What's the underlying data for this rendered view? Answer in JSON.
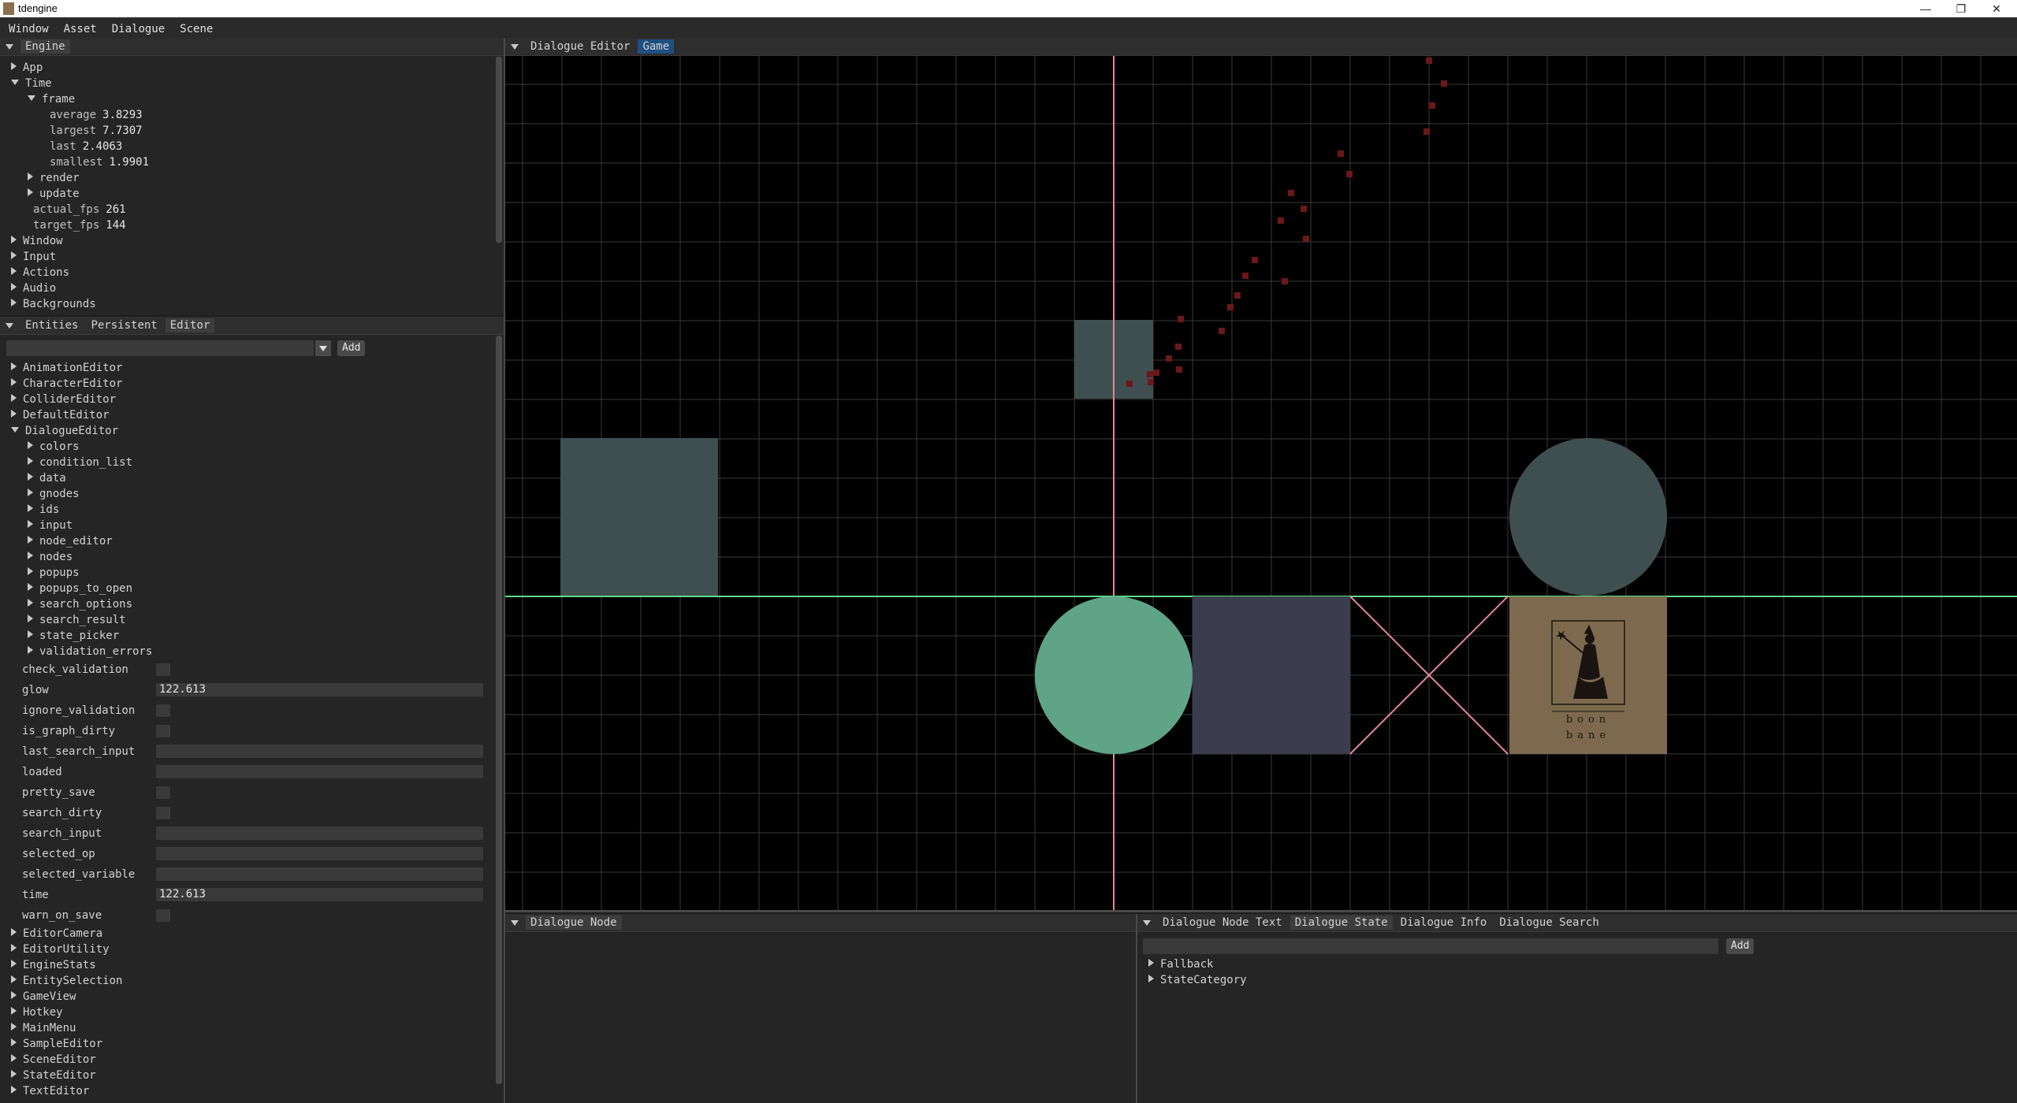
{
  "window": {
    "title": "tdengine",
    "controls": {
      "minimize": "—",
      "maximize": "❐",
      "close": "✕"
    }
  },
  "menu": [
    "Window",
    "Asset",
    "Dialogue",
    "Scene"
  ],
  "engine_panel": {
    "tab": "Engine",
    "tree": [
      {
        "label": "App",
        "expanded": false,
        "depth": 0
      },
      {
        "label": "Time",
        "expanded": true,
        "depth": 0
      },
      {
        "label": "frame",
        "expanded": true,
        "depth": 1
      },
      {
        "key": "average",
        "value": "3.8293",
        "depth": 2
      },
      {
        "key": "largest",
        "value": "7.7307",
        "depth": 2
      },
      {
        "key": "last",
        "value": "2.4063",
        "depth": 2
      },
      {
        "key": "smallest",
        "value": "1.9901",
        "depth": 2
      },
      {
        "label": "render",
        "expanded": false,
        "depth": 1
      },
      {
        "label": "update",
        "expanded": false,
        "depth": 1
      },
      {
        "key": "actual_fps",
        "value": "261",
        "depth": 1
      },
      {
        "key": "target_fps",
        "value": "144",
        "depth": 1
      },
      {
        "label": "Window",
        "expanded": false,
        "depth": 0
      },
      {
        "label": "Input",
        "expanded": false,
        "depth": 0
      },
      {
        "label": "Actions",
        "expanded": false,
        "depth": 0
      },
      {
        "label": "Audio",
        "expanded": false,
        "depth": 0
      },
      {
        "label": "Backgrounds",
        "expanded": false,
        "depth": 0
      }
    ]
  },
  "entities_panel": {
    "tabs": [
      "Entities",
      "Persistent",
      "Editor"
    ],
    "active_tab": "Editor",
    "search": {
      "value": "",
      "add_label": "Add"
    },
    "tree": [
      {
        "label": "AnimationEditor",
        "expanded": false,
        "depth": 0
      },
      {
        "label": "CharacterEditor",
        "expanded": false,
        "depth": 0
      },
      {
        "label": "ColliderEditor",
        "expanded": false,
        "depth": 0
      },
      {
        "label": "DefaultEditor",
        "expanded": false,
        "depth": 0
      },
      {
        "label": "DialogueEditor",
        "expanded": true,
        "depth": 0
      },
      {
        "label": "colors",
        "expanded": false,
        "depth": 1
      },
      {
        "label": "condition_list",
        "expanded": false,
        "depth": 1
      },
      {
        "label": "data",
        "expanded": false,
        "depth": 1
      },
      {
        "label": "gnodes",
        "expanded": false,
        "depth": 1
      },
      {
        "label": "ids",
        "expanded": false,
        "depth": 1
      },
      {
        "label": "input",
        "expanded": false,
        "depth": 1
      },
      {
        "label": "node_editor",
        "expanded": false,
        "depth": 1
      },
      {
        "label": "nodes",
        "expanded": false,
        "depth": 1
      },
      {
        "label": "popups",
        "expanded": false,
        "depth": 1
      },
      {
        "label": "popups_to_open",
        "expanded": false,
        "depth": 1
      },
      {
        "label": "search_options",
        "expanded": false,
        "depth": 1
      },
      {
        "label": "search_result",
        "expanded": false,
        "depth": 1
      },
      {
        "label": "state_picker",
        "expanded": false,
        "depth": 1
      },
      {
        "label": "validation_errors",
        "expanded": false,
        "depth": 1
      }
    ],
    "properties": [
      {
        "name": "check_validation",
        "kind": "check"
      },
      {
        "name": "glow",
        "kind": "field",
        "value": "122.613"
      },
      {
        "name": "ignore_validation",
        "kind": "check"
      },
      {
        "name": "is_graph_dirty",
        "kind": "check"
      },
      {
        "name": "last_search_input",
        "kind": "field",
        "value": ""
      },
      {
        "name": "loaded",
        "kind": "field",
        "value": ""
      },
      {
        "name": "pretty_save",
        "kind": "check"
      },
      {
        "name": "search_dirty",
        "kind": "check"
      },
      {
        "name": "search_input",
        "kind": "field",
        "value": ""
      },
      {
        "name": "selected_op",
        "kind": "field",
        "value": ""
      },
      {
        "name": "selected_variable",
        "kind": "field",
        "value": ""
      },
      {
        "name": "time",
        "kind": "field",
        "value": "122.613"
      },
      {
        "name": "warn_on_save",
        "kind": "check"
      }
    ],
    "tree_after": [
      "EditorCamera",
      "EditorUtility",
      "EngineStats",
      "EntitySelection",
      "GameView",
      "Hotkey",
      "MainMenu",
      "SampleEditor",
      "SceneEditor",
      "StateEditor",
      "TextEditor"
    ]
  },
  "viewport": {
    "tabs": [
      "Dialogue Editor",
      "Game"
    ],
    "active_tab": "Game",
    "logo": {
      "line1": "boon",
      "line2": "bane"
    },
    "colors": {
      "background": "#000000",
      "grid": "#3a3a3a",
      "axis_vertical": "#e38a9a",
      "axis_horizontal": "#5fdc8a",
      "teal_shape": "#3f4f4f",
      "green_circle": "#5fa486",
      "slate_square": "#3b3c4d",
      "logo_bg": "#7d6a4e",
      "trail": "#6b1818"
    }
  },
  "dialogue_node_panel": {
    "tab": "Dialogue Node"
  },
  "dialogue_state_panel": {
    "tabs": [
      "Dialogue Node Text",
      "Dialogue State",
      "Dialogue Info",
      "Dialogue Search"
    ],
    "active_tab": "Dialogue State",
    "search": {
      "value": "",
      "add_label": "Add"
    },
    "tree": [
      {
        "label": "Fallback",
        "expanded": false
      },
      {
        "label": "StateCategory",
        "expanded": false
      }
    ]
  }
}
